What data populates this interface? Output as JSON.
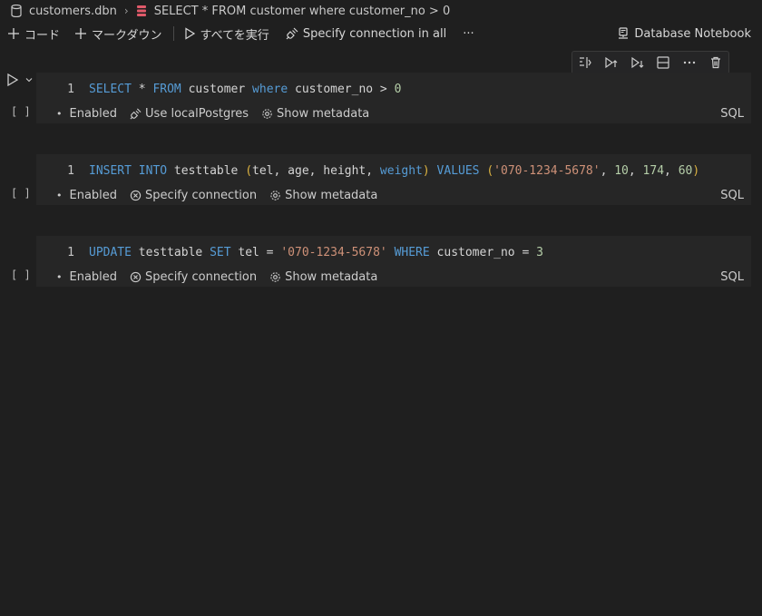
{
  "breadcrumb": {
    "file": "customers.dbn",
    "query": "SELECT * FROM customer where customer_no > 0"
  },
  "toolbar": {
    "add_code": "コード",
    "add_markdown": "マークダウン",
    "run_all": "すべてを実行",
    "specify_connection_all": "Specify connection in all",
    "more": "···",
    "kernel_label": "Database Notebook"
  },
  "cells": [
    {
      "exec_count": "[ ]",
      "line_number": "1",
      "tokens": [
        {
          "t": "SELECT",
          "c": "kw"
        },
        {
          "t": " * ",
          "c": "op"
        },
        {
          "t": "FROM",
          "c": "kw"
        },
        {
          "t": " customer ",
          "c": "txt"
        },
        {
          "t": "where",
          "c": "kw"
        },
        {
          "t": " customer_no > ",
          "c": "txt"
        },
        {
          "t": "0",
          "c": "num"
        }
      ],
      "status_enabled": "Enabled",
      "connection": "Use localPostgres",
      "metadata": "Show metadata",
      "language": "SQL"
    },
    {
      "exec_count": "[ ]",
      "line_number": "1",
      "tokens": [
        {
          "t": "INSERT",
          "c": "kw"
        },
        {
          "t": " ",
          "c": "txt"
        },
        {
          "t": "INTO",
          "c": "kw"
        },
        {
          "t": " testtable ",
          "c": "txt"
        },
        {
          "t": "(",
          "c": "paren"
        },
        {
          "t": "tel, age, height, ",
          "c": "txt"
        },
        {
          "t": "weight",
          "c": "kw"
        },
        {
          "t": ")",
          "c": "paren"
        },
        {
          "t": " ",
          "c": "txt"
        },
        {
          "t": "VALUES",
          "c": "kw"
        },
        {
          "t": " ",
          "c": "txt"
        },
        {
          "t": "(",
          "c": "paren"
        },
        {
          "t": "'070-1234-5678'",
          "c": "str"
        },
        {
          "t": ", ",
          "c": "txt"
        },
        {
          "t": "10",
          "c": "num"
        },
        {
          "t": ", ",
          "c": "txt"
        },
        {
          "t": "174",
          "c": "num"
        },
        {
          "t": ", ",
          "c": "txt"
        },
        {
          "t": "60",
          "c": "num"
        },
        {
          "t": ")",
          "c": "paren"
        }
      ],
      "status_enabled": "Enabled",
      "connection": "Specify connection",
      "metadata": "Show metadata",
      "language": "SQL"
    },
    {
      "exec_count": "[ ]",
      "line_number": "1",
      "tokens": [
        {
          "t": "UPDATE",
          "c": "kw"
        },
        {
          "t": " testtable ",
          "c": "txt"
        },
        {
          "t": "SET",
          "c": "kw"
        },
        {
          "t": " tel = ",
          "c": "txt"
        },
        {
          "t": "'070-1234-5678'",
          "c": "str"
        },
        {
          "t": " ",
          "c": "txt"
        },
        {
          "t": "WHERE",
          "c": "kw"
        },
        {
          "t": " customer_no = ",
          "c": "txt"
        },
        {
          "t": "3",
          "c": "num"
        }
      ],
      "status_enabled": "Enabled",
      "connection": "Specify connection",
      "metadata": "Show metadata",
      "language": "SQL"
    }
  ],
  "icons": {
    "breadcrumb_file": "database-icon",
    "breadcrumb_query": "sql-stack-icon",
    "run_cell": "play-icon",
    "cell_toolbar": [
      "split-cell-icon",
      "run-above-icon",
      "run-below-icon",
      "collapse-icon",
      "more-icon",
      "trash-icon"
    ]
  }
}
